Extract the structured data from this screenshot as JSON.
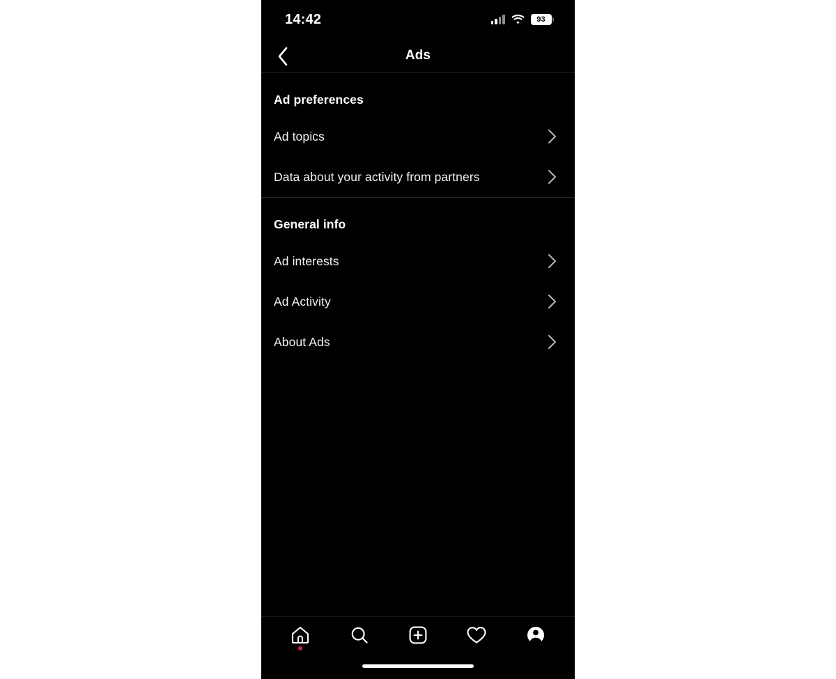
{
  "status_bar": {
    "time": "14:42",
    "signal_icon": "cellular-signal-icon",
    "wifi_icon": "wifi-icon",
    "battery_percent": "93",
    "battery_icon": "battery-icon"
  },
  "header": {
    "back_icon": "chevron-left-icon",
    "title": "Ads"
  },
  "sections": [
    {
      "title": "Ad preferences",
      "rows": [
        {
          "label": "Ad topics",
          "chevron": "chevron-right-icon"
        },
        {
          "label": "Data about your activity from partners",
          "chevron": "chevron-right-icon"
        }
      ]
    },
    {
      "title": "General info",
      "rows": [
        {
          "label": "Ad interests",
          "chevron": "chevron-right-icon"
        },
        {
          "label": "Ad Activity",
          "chevron": "chevron-right-icon"
        },
        {
          "label": "About Ads",
          "chevron": "chevron-right-icon"
        }
      ]
    }
  ],
  "tabbar": {
    "items": [
      {
        "name": "home",
        "icon": "home-icon",
        "badge": true
      },
      {
        "name": "search",
        "icon": "search-icon",
        "badge": false
      },
      {
        "name": "create",
        "icon": "plus-square-icon",
        "badge": false
      },
      {
        "name": "activity",
        "icon": "heart-icon",
        "badge": false
      },
      {
        "name": "profile",
        "icon": "profile-avatar-icon",
        "badge": false
      }
    ]
  },
  "colors": {
    "background": "#000000",
    "text": "#ffffff",
    "muted_text": "#f2f2f2",
    "divider": "#262626",
    "notification_dot": "#cc1f3d",
    "page_surround": "#ffffff"
  },
  "home_indicator": "home-indicator-bar"
}
